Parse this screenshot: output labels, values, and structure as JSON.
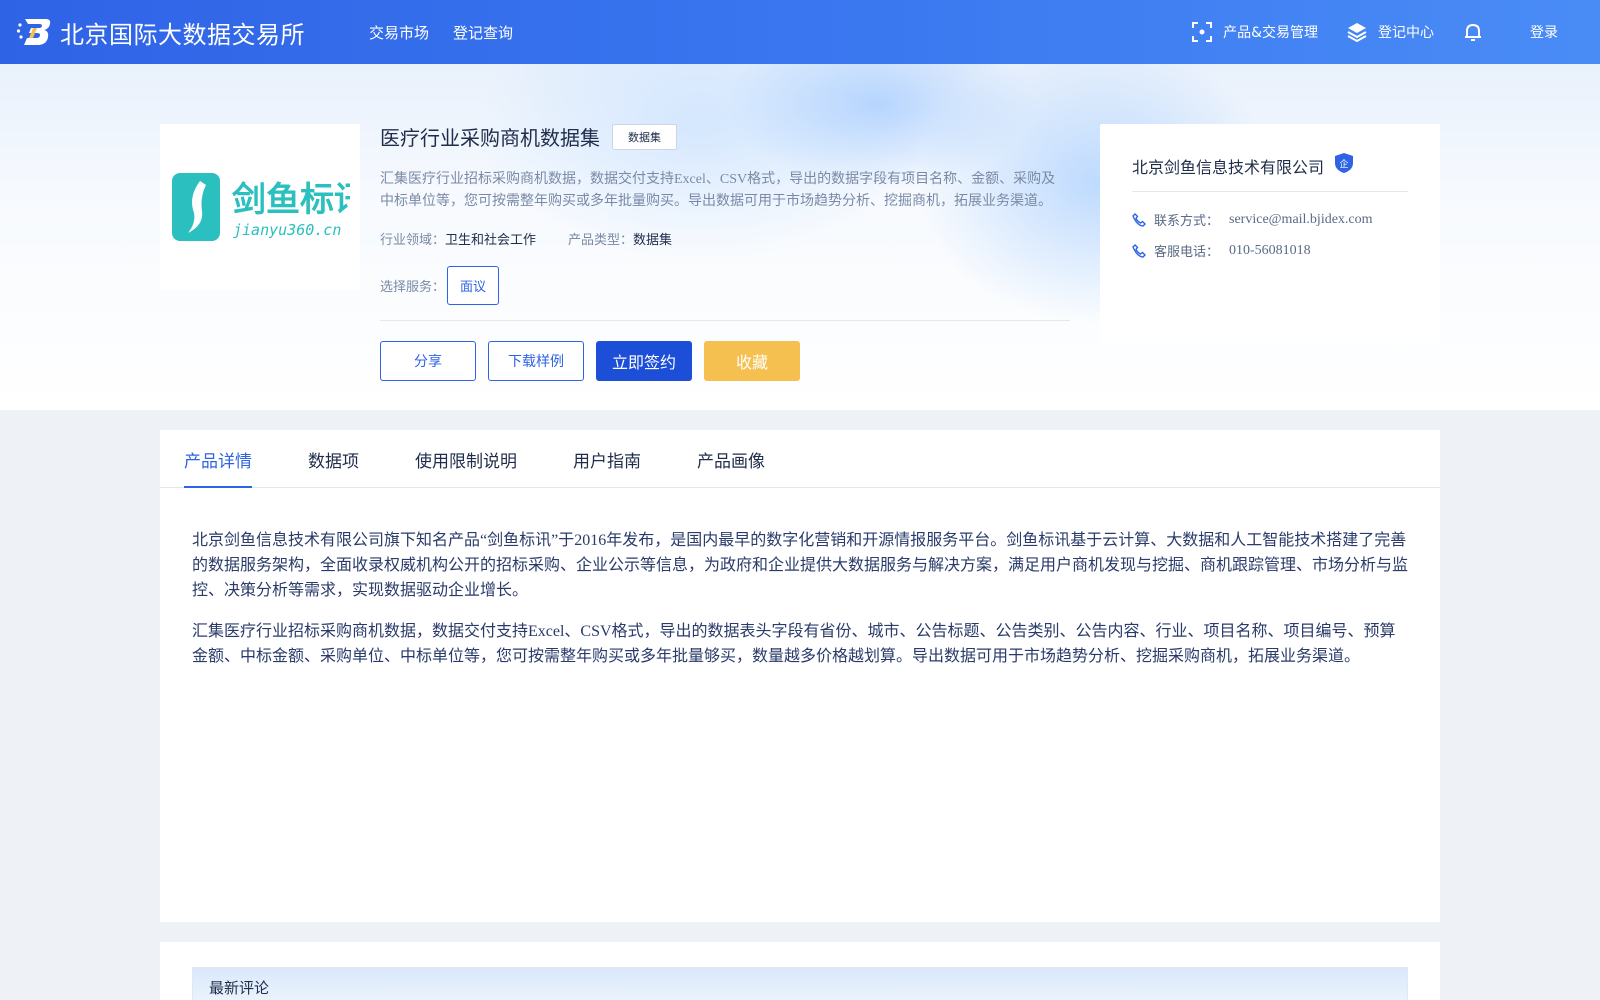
{
  "header": {
    "site_title": "北京国际大数据交易所",
    "nav": [
      {
        "label": "交易市场"
      },
      {
        "label": "登记查询"
      }
    ],
    "right": {
      "product_mgmt": "产品&交易管理",
      "register_center": "登记中心",
      "login": "登录"
    },
    "colors": {
      "bar_start": "#2f63e6",
      "bar_end": "#4a8cf6"
    }
  },
  "product": {
    "logo_text": "剑鱼标讯",
    "logo_subtext": "jianyu360.cn",
    "title": "医疗行业采购商机数据集",
    "tag": "数据集",
    "description": "汇集医疗行业招标采购商机数据，数据交付支持Excel、CSV格式，导出的数据字段有项目名称、金额、采购及中标单位等，您可按需整年购买或多年批量购买。导出数据可用于市场趋势分析、挖掘商机，拓展业务渠道。",
    "industry_label": "行业领域：",
    "industry_value": "卫生和社会工作",
    "type_label": "产品类型：",
    "type_value": "数据集",
    "service_label": "选择服务：",
    "service_option": "面议",
    "actions": {
      "share": "分享",
      "download_sample": "下载样例",
      "sign_now": "立即签约",
      "favorite": "收藏"
    }
  },
  "company": {
    "name": "北京剑鱼信息技术有限公司",
    "badge": "企",
    "contact_label": "联系方式：",
    "contact_value": "service@mail.bjidex.com",
    "phone_label": "客服电话：",
    "phone_value": "010-56081018"
  },
  "tabs": [
    {
      "label": "产品详情",
      "active": true
    },
    {
      "label": "数据项"
    },
    {
      "label": "使用限制说明"
    },
    {
      "label": "用户指南"
    },
    {
      "label": "产品画像"
    }
  ],
  "details": {
    "paragraph_1": "北京剑鱼信息技术有限公司旗下知名产品“剑鱼标讯”于2016年发布，是国内最早的数字化营销和开源情报服务平台。剑鱼标讯基于云计算、大数据和人工智能技术搭建了完善的数据服务架构，全面收录权威机构公开的招标采购、企业公示等信息，为政府和企业提供大数据服务与解决方案，满足用户商机发现与挖掘、商机跟踪管理、市场分析与监控、决策分析等需求，实现数据驱动企业增长。",
    "paragraph_2": "汇集医疗行业招标采购商机数据，数据交付支持Excel、CSV格式，导出的数据表头字段有省份、城市、公告标题、公告类别、公告内容、行业、项目名称、项目编号、预算金额、中标金额、采购单位、中标单位等，您可按需整年购买或多年批量够买，数量越多价格越划算。导出数据可用于市场趋势分析、挖掘采购商机，拓展业务渠道。"
  },
  "comments": {
    "title": "最新评论"
  }
}
